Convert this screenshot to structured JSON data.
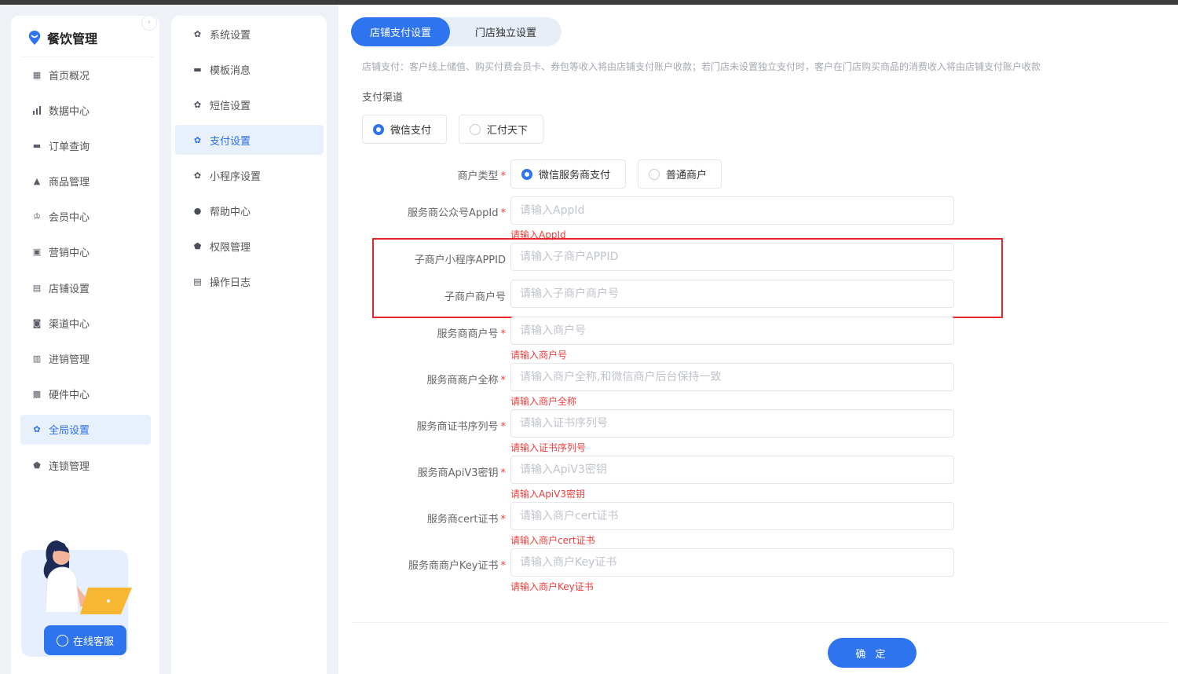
{
  "app": {
    "title": "餐饮管理",
    "brand_color": "#2e74ee"
  },
  "primary_nav": [
    {
      "label": "首页概况",
      "icon": "grid-icon"
    },
    {
      "label": "数据中心",
      "icon": "bar-chart-icon"
    },
    {
      "label": "订单查询",
      "icon": "list-icon"
    },
    {
      "label": "商品管理",
      "icon": "bag-icon"
    },
    {
      "label": "会员中心",
      "icon": "crown-icon"
    },
    {
      "label": "营销中心",
      "icon": "tag-icon"
    },
    {
      "label": "店铺设置",
      "icon": "store-icon"
    },
    {
      "label": "渠道中心",
      "icon": "channel-icon"
    },
    {
      "label": "进销管理",
      "icon": "inventory-icon"
    },
    {
      "label": "硬件中心",
      "icon": "hardware-icon"
    },
    {
      "label": "全局设置",
      "icon": "gear-icon",
      "active": true
    },
    {
      "label": "连锁管理",
      "icon": "chain-icon"
    }
  ],
  "service": {
    "label": "在线客服"
  },
  "secondary_nav": [
    {
      "label": "系统设置",
      "icon": "gear-icon"
    },
    {
      "label": "模板消息",
      "icon": "message-icon"
    },
    {
      "label": "短信设置",
      "icon": "gear-icon"
    },
    {
      "label": "支付设置",
      "icon": "gear-icon",
      "active": true
    },
    {
      "label": "小程序设置",
      "icon": "gear-icon"
    },
    {
      "label": "帮助中心",
      "icon": "info-icon"
    },
    {
      "label": "权限管理",
      "icon": "shield-icon"
    },
    {
      "label": "操作日志",
      "icon": "log-icon"
    }
  ],
  "tabs": [
    {
      "label": "店铺支付设置",
      "active": true
    },
    {
      "label": "门店独立设置",
      "active": false
    }
  ],
  "notice": "店铺支付：客户线上储值、购买付费会员卡、券包等收入将由店铺支付账户收款；若门店未设置独立支付时，客户在门店购买商品的消费收入将由店铺支付账户收款",
  "payment_channel": {
    "label": "支付渠道",
    "options": [
      {
        "label": "微信支付",
        "checked": true
      },
      {
        "label": "汇付天下",
        "checked": false
      }
    ]
  },
  "merchant_type": {
    "label": "商户类型",
    "options": [
      {
        "label": "微信服务商支付",
        "checked": true
      },
      {
        "label": "普通商户",
        "checked": false
      }
    ]
  },
  "fields": [
    {
      "label": "服务商公众号AppId",
      "required": true,
      "placeholder": "请输入AppId",
      "error": "请输入AppId"
    },
    {
      "label": "子商户小程序APPID",
      "required": false,
      "placeholder": "请输入子商户APPID",
      "error": ""
    },
    {
      "label": "子商户商户号",
      "required": false,
      "placeholder": "请输入子商户商户号",
      "error": ""
    },
    {
      "label": "服务商商户号",
      "required": true,
      "placeholder": "请输入商户号",
      "error": "请输入商户号"
    },
    {
      "label": "服务商商户全称",
      "required": true,
      "placeholder": "请输入商户全称,和微信商户后台保持一致",
      "error": "请输入商户全称"
    },
    {
      "label": "服务商证书序列号",
      "required": true,
      "placeholder": "请输入证书序列号",
      "error": "请输入证书序列号"
    },
    {
      "label": "服务商ApiV3密钥",
      "required": true,
      "placeholder": "请输入ApiV3密钥",
      "error": "请输入ApiV3密钥"
    },
    {
      "label": "服务商cert证书",
      "required": true,
      "placeholder": "请输入商户cert证书",
      "error": "请输入商户cert证书"
    },
    {
      "label": "服务商商户Key证书",
      "required": true,
      "placeholder": "请输入商户Key证书",
      "error": "请输入商户Key证书"
    }
  ],
  "confirm_label": "确 定",
  "colors": {
    "accent": "#2e74ee",
    "active_bg": "#e8f0fc",
    "error": "#f03c3c",
    "highlight": "#e8252a"
  }
}
